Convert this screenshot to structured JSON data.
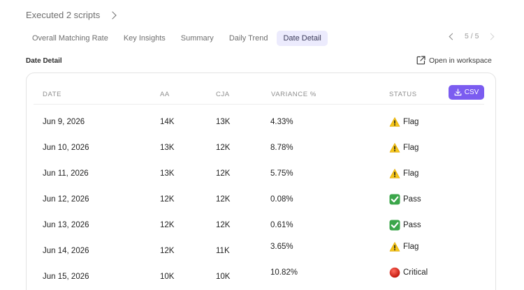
{
  "execution": {
    "label": "Executed 2 scripts"
  },
  "tabs": [
    {
      "label": "Overall Matching Rate",
      "active": false
    },
    {
      "label": "Key Insights",
      "active": false
    },
    {
      "label": "Summary",
      "active": false
    },
    {
      "label": "Daily Trend",
      "active": false
    },
    {
      "label": "Date Detail",
      "active": true
    }
  ],
  "pager": {
    "text": "5 / 5"
  },
  "section": {
    "title": "Date Detail",
    "open_workspace": "Open in workspace"
  },
  "table": {
    "headers": {
      "date": "DATE",
      "aa": "AA",
      "cja": "CJA",
      "variance": "VARIANCE %",
      "status": "STATUS"
    },
    "csv_button": "CSV",
    "rows": [
      {
        "date": "Jun 9, 2026",
        "aa": "14K",
        "cja": "13K",
        "variance": "4.33%",
        "status": "Flag",
        "icon": "warning-icon"
      },
      {
        "date": "Jun 10, 2026",
        "aa": "13K",
        "cja": "12K",
        "variance": "8.78%",
        "status": "Flag",
        "icon": "warning-icon"
      },
      {
        "date": "Jun 11, 2026",
        "aa": "13K",
        "cja": "12K",
        "variance": "5.75%",
        "status": "Flag",
        "icon": "warning-icon"
      },
      {
        "date": "Jun 12, 2026",
        "aa": "12K",
        "cja": "12K",
        "variance": "0.08%",
        "status": "Pass",
        "icon": "check-icon"
      },
      {
        "date": "Jun 13, 2026",
        "aa": "12K",
        "cja": "12K",
        "variance": "0.61%",
        "status": "Pass",
        "icon": "check-icon"
      },
      {
        "date": "Jun 14, 2026",
        "aa": "12K",
        "cja": "11K",
        "variance": "3.65%",
        "status": "Flag",
        "icon": "warning-icon"
      },
      {
        "date": "Jun 15, 2026",
        "aa": "10K",
        "cja": "10K",
        "variance": "10.82%",
        "status": "Critical",
        "icon": "critical-icon"
      }
    ]
  },
  "colors": {
    "accent": "#7b5cf0",
    "active_tab_bg": "#ecebfd",
    "pass": "#3ba64a",
    "warning": "#f5c518",
    "critical": "#d9291c"
  }
}
